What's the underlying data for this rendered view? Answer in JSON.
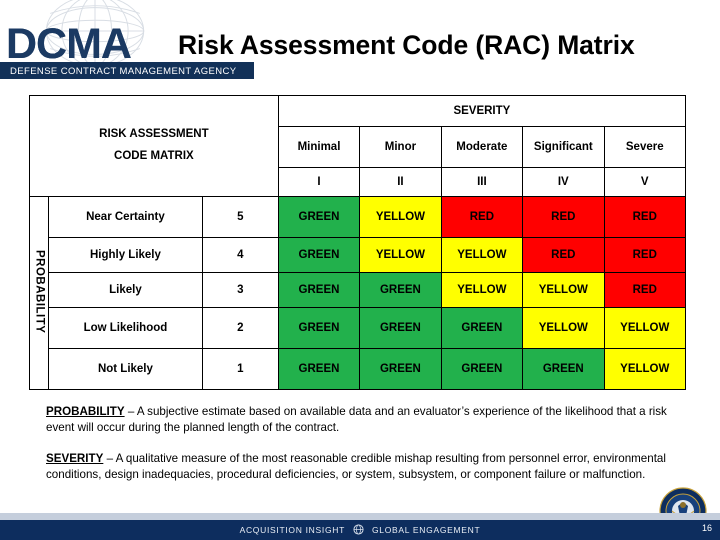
{
  "header": {
    "logo_text": "DCMA",
    "agency_bar": "DEFENSE CONTRACT MANAGEMENT AGENCY",
    "title": "Risk Assessment Code (RAC) Matrix",
    "logo_icon": "globe-wireframe-icon"
  },
  "matrix": {
    "corner_title_line1": "RISK ASSESSMENT",
    "corner_title_line2": "CODE MATRIX",
    "severity_header": "SEVERITY",
    "probability_axis": "PROBABILITY",
    "severity_names": [
      "Minimal",
      "Minor",
      "Moderate",
      "Significant",
      "Severe"
    ],
    "severity_romans": [
      "I",
      "II",
      "III",
      "IV",
      "V"
    ],
    "rows": [
      {
        "label": "Near Certainty",
        "value": "5",
        "cells": [
          {
            "text": "GREEN",
            "level": "green"
          },
          {
            "text": "YELLOW",
            "level": "yellow"
          },
          {
            "text": "RED",
            "level": "red"
          },
          {
            "text": "RED",
            "level": "red"
          },
          {
            "text": "RED",
            "level": "red"
          }
        ]
      },
      {
        "label": "Highly Likely",
        "value": "4",
        "cells": [
          {
            "text": "GREEN",
            "level": "green"
          },
          {
            "text": "YELLOW",
            "level": "yellow"
          },
          {
            "text": "YELLOW",
            "level": "yellow"
          },
          {
            "text": "RED",
            "level": "red"
          },
          {
            "text": "RED",
            "level": "red"
          }
        ]
      },
      {
        "label": "Likely",
        "value": "3",
        "cells": [
          {
            "text": "GREEN",
            "level": "green"
          },
          {
            "text": "GREEN",
            "level": "green"
          },
          {
            "text": "YELLOW",
            "level": "yellow"
          },
          {
            "text": "YELLOW",
            "level": "yellow"
          },
          {
            "text": "RED",
            "level": "red"
          }
        ]
      },
      {
        "label": "Low Likelihood",
        "value": "2",
        "cells": [
          {
            "text": "GREEN",
            "level": "green"
          },
          {
            "text": "GREEN",
            "level": "green"
          },
          {
            "text": "GREEN",
            "level": "green"
          },
          {
            "text": "YELLOW",
            "level": "yellow"
          },
          {
            "text": "YELLOW",
            "level": "yellow"
          }
        ]
      },
      {
        "label": "Not Likely",
        "value": "1",
        "cells": [
          {
            "text": "GREEN",
            "level": "green"
          },
          {
            "text": "GREEN",
            "level": "green"
          },
          {
            "text": "GREEN",
            "level": "green"
          },
          {
            "text": "GREEN",
            "level": "green"
          },
          {
            "text": "YELLOW",
            "level": "yellow"
          }
        ]
      }
    ]
  },
  "notes": [
    {
      "term": "PROBABILITY",
      "body": " – A subjective estimate based on available data and an evaluator’s experience of the likelihood that a risk event will occur during the planned length of the contract."
    },
    {
      "term": "SEVERITY",
      "body": " – A qualitative measure of the most reasonable credible mishap resulting from personnel error, environmental conditions, design inadequacies, procedural deficiencies, or system, subsystem, or component failure or malfunction."
    }
  ],
  "footer": {
    "text_left": "ACQUISITION INSIGHT",
    "text_right": "GLOBAL ENGAGEMENT",
    "globe_icon": "globe-icon",
    "page_number": "16",
    "seal_icon": "dcma-agency-seal-icon"
  },
  "colors": {
    "green": "#22B14C",
    "yellow": "#FFFF00",
    "red": "#FF0000",
    "navy": "#123158",
    "footer_navy": "#0D2D5E",
    "footer_strip": "#C5CEDC"
  }
}
